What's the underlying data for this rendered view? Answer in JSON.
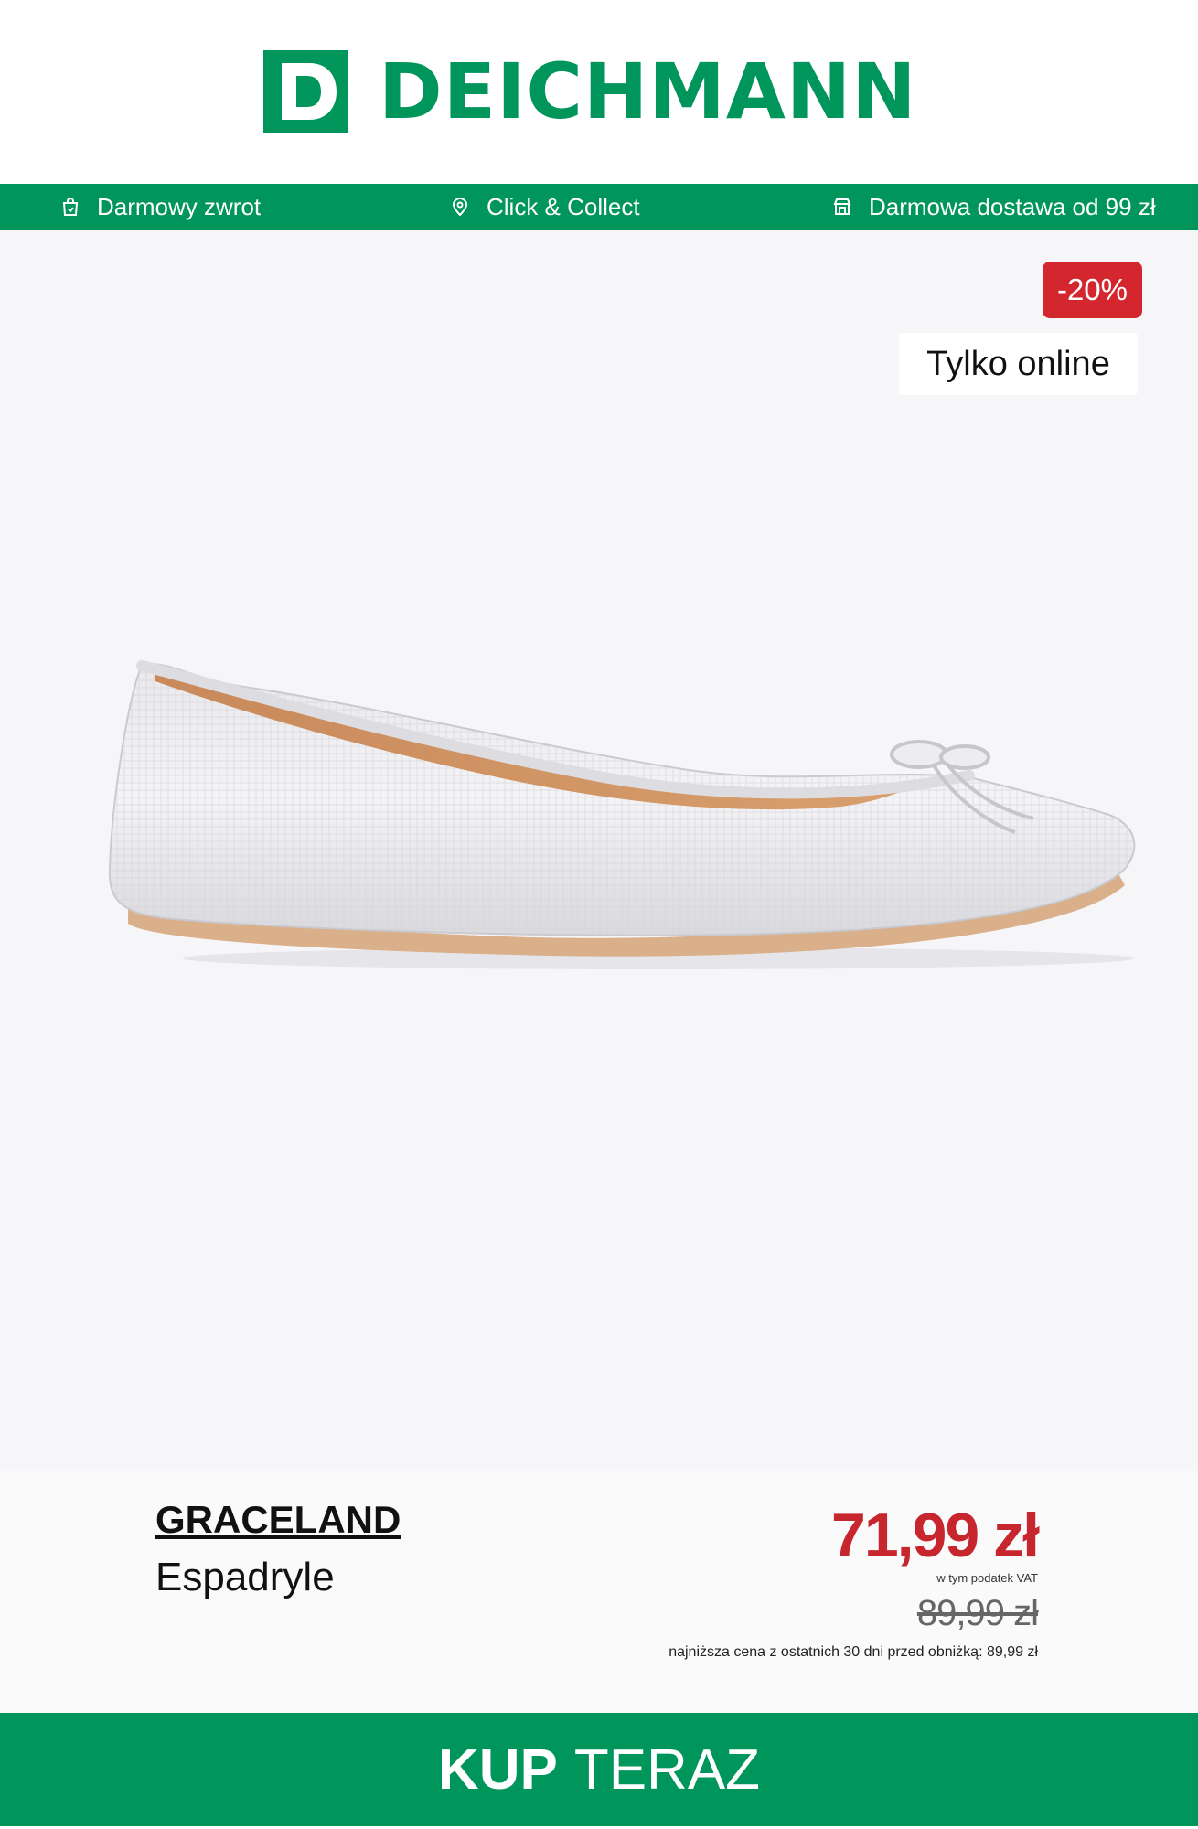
{
  "header": {
    "logo_letter": "D",
    "logo_text": "DEICHMANN",
    "brand_color": "#00955a"
  },
  "topbar": {
    "items": [
      {
        "icon": "return-bag-icon",
        "label": "Darmowy zwrot"
      },
      {
        "icon": "location-pin-icon",
        "label": "Click & Collect"
      },
      {
        "icon": "store-icon",
        "label": "Darmowa dostawa od 99 zł"
      }
    ]
  },
  "badges": {
    "discount": "-20%",
    "online": "Tylko online",
    "discount_color": "#d4262e"
  },
  "product": {
    "image": "silver-ballet-flat-shoe",
    "brand": "GRACELAND",
    "name": "Espadryle",
    "price": "71,99 zł",
    "vat_note": "w tym podatek VAT",
    "old_price": "89,99 zł",
    "lowest_price_note": "najniższa cena z ostatnich 30 dni przed obniżką: 89,99 zł",
    "price_color": "#c8262e"
  },
  "cta": {
    "bold": "KUP",
    "regular": "TERAZ"
  }
}
